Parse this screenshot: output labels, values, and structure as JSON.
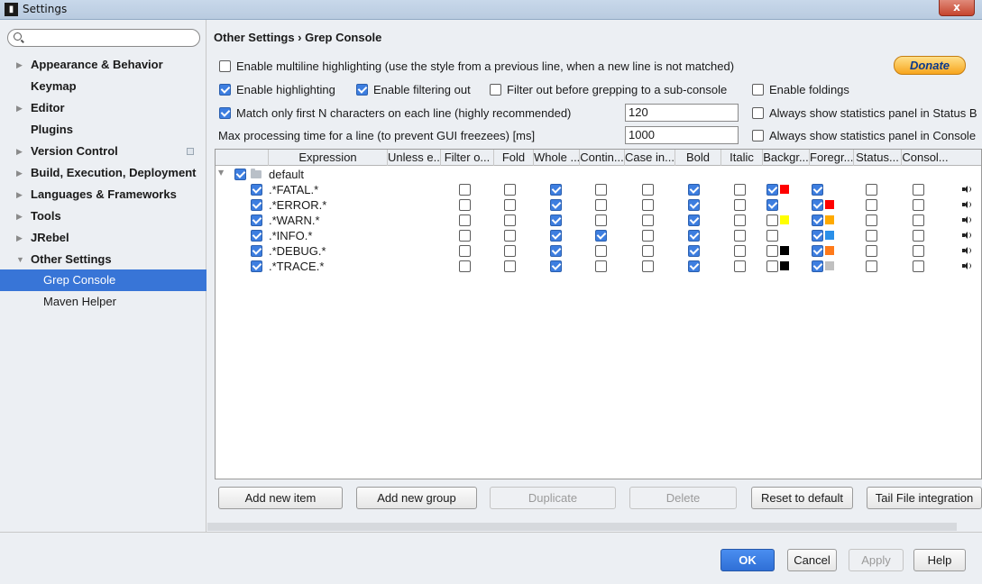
{
  "window": {
    "title": "Settings",
    "app_icon": "idea-icon",
    "close_label": "x"
  },
  "sidebar": {
    "search_placeholder": "",
    "items": [
      {
        "label": "Appearance & Behavior",
        "expandable": true
      },
      {
        "label": "Keymap",
        "expandable": false
      },
      {
        "label": "Editor",
        "expandable": true
      },
      {
        "label": "Plugins",
        "expandable": false
      },
      {
        "label": "Version Control",
        "expandable": true
      },
      {
        "label": "Build, Execution, Deployment",
        "expandable": true
      },
      {
        "label": "Languages & Frameworks",
        "expandable": true
      },
      {
        "label": "Tools",
        "expandable": true
      },
      {
        "label": "JRebel",
        "expandable": true
      },
      {
        "label": "Other Settings",
        "expandable": true,
        "expanded": true
      },
      {
        "label": "Grep Console",
        "selected": true
      },
      {
        "label": "Maven Helper"
      }
    ]
  },
  "breadcrumb": "Other Settings › Grep Console",
  "options": {
    "multiline": {
      "label": "Enable multiline highlighting (use the style from a previous line, when a new line is not matched)",
      "checked": false
    },
    "donate_label": "Donate",
    "enable_highlighting": {
      "label": "Enable highlighting",
      "checked": true
    },
    "enable_filtering": {
      "label": "Enable filtering out",
      "checked": true
    },
    "filter_before_grep": {
      "label": "Filter out before grepping to a sub-console",
      "checked": false
    },
    "enable_foldings": {
      "label": "Enable foldings",
      "checked": false
    },
    "match_first_n": {
      "label": "Match only first N characters on each line (highly recommended)",
      "checked": true,
      "value": "120"
    },
    "stats_status_bar": {
      "label": "Always show statistics panel in Status B",
      "checked": false
    },
    "max_processing": {
      "label": "Max processing time for a line (to prevent GUI freezees) [ms]",
      "value": "1000"
    },
    "stats_console": {
      "label": "Always show statistics panel in Console",
      "checked": false
    }
  },
  "table": {
    "columns": [
      "Expression",
      "Unless e...",
      "Filter o...",
      "Fold",
      "Whole ...",
      "Contin...",
      "Case in...",
      "Bold",
      "Italic",
      "Backgr...",
      "Foregr...",
      "Status...",
      "Consol..."
    ],
    "group": {
      "name": "default",
      "checked": true
    },
    "rows": [
      {
        "expression": ".*FATAL.*",
        "enabled": true,
        "filter": false,
        "fold": false,
        "whole": true,
        "contin": false,
        "case": false,
        "bold": true,
        "italic": false,
        "bg_checked": true,
        "bg_color": "#ff0000",
        "fg_checked": true,
        "fg_color": "",
        "status": false,
        "console": false
      },
      {
        "expression": ".*ERROR.*",
        "enabled": true,
        "filter": false,
        "fold": false,
        "whole": true,
        "contin": false,
        "case": false,
        "bold": true,
        "italic": false,
        "bg_checked": true,
        "bg_color": "",
        "fg_checked": true,
        "fg_color": "#ff0000",
        "status": false,
        "console": false
      },
      {
        "expression": ".*WARN.*",
        "enabled": true,
        "filter": false,
        "fold": false,
        "whole": true,
        "contin": false,
        "case": false,
        "bold": true,
        "italic": false,
        "bg_checked": false,
        "bg_color": "#ffff00",
        "fg_checked": true,
        "fg_color": "#ffaa00",
        "status": false,
        "console": false
      },
      {
        "expression": ".*INFO.*",
        "enabled": true,
        "filter": false,
        "fold": false,
        "whole": true,
        "contin": true,
        "case": false,
        "bold": true,
        "italic": false,
        "bg_checked": false,
        "bg_color": "",
        "fg_checked": true,
        "fg_color": "#2a8fe8",
        "status": false,
        "console": false
      },
      {
        "expression": ".*DEBUG.*",
        "enabled": true,
        "filter": false,
        "fold": false,
        "whole": true,
        "contin": false,
        "case": false,
        "bold": true,
        "italic": false,
        "bg_checked": false,
        "bg_color": "#000000",
        "fg_checked": true,
        "fg_color": "#ff7a1a",
        "status": false,
        "console": false
      },
      {
        "expression": ".*TRACE.*",
        "enabled": true,
        "filter": false,
        "fold": false,
        "whole": true,
        "contin": false,
        "case": false,
        "bold": true,
        "italic": false,
        "bg_checked": false,
        "bg_color": "#000000",
        "fg_checked": true,
        "fg_color": "#c0c0c0",
        "status": false,
        "console": false
      }
    ]
  },
  "buttons": {
    "add_item": "Add new item",
    "add_group": "Add new group",
    "duplicate": "Duplicate",
    "delete": "Delete",
    "reset": "Reset to default",
    "tail": "Tail File integration"
  },
  "footer": {
    "ok": "OK",
    "cancel": "Cancel",
    "apply": "Apply",
    "help": "Help"
  }
}
